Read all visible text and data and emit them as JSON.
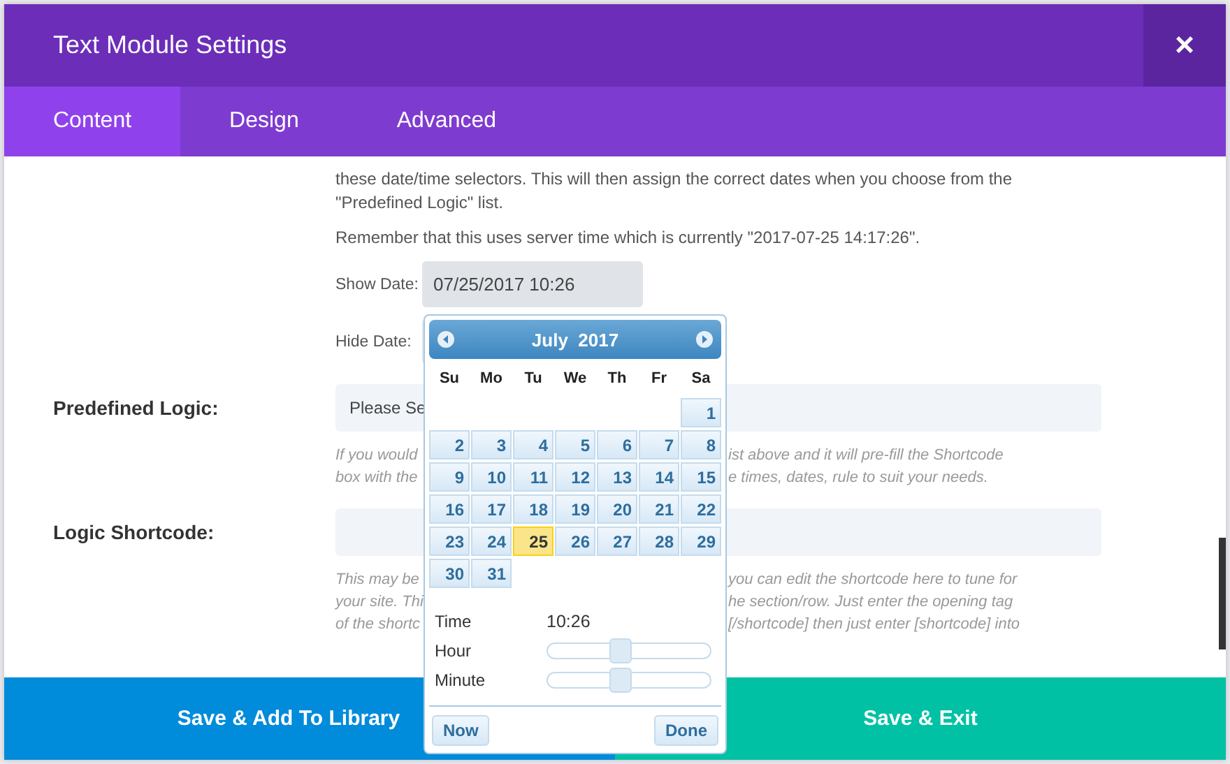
{
  "window": {
    "title": "Text Module Settings",
    "close": "×"
  },
  "tabs": [
    {
      "label": "Content",
      "selected": true
    },
    {
      "label": "Design",
      "selected": false
    },
    {
      "label": "Advanced",
      "selected": false
    }
  ],
  "intro": [
    "these date/time selectors. This will then assign the correct dates when you choose from the \"Predefined Logic\" list.",
    "Remember that this uses server time which is currently \"2017-07-25 14:17:26\"."
  ],
  "show_date": {
    "label": "Show Date:",
    "value": "07/25/2017 10:26"
  },
  "hide_date": {
    "label": "Hide Date:"
  },
  "predefined": {
    "label": "Predefined Logic:",
    "value": "Please Se",
    "help": [
      [
        "If you would",
        "ist above and it will pre-fill the Shortcode"
      ],
      [
        "box with the",
        "e times, dates, rule to suit your needs."
      ]
    ]
  },
  "shortcode": {
    "label": "Logic Shortcode:",
    "help": [
      [
        "This may be",
        "you can edit the shortcode here to tune for"
      ],
      [
        "your site. Thi",
        "he section/row. Just enter the opening tag"
      ],
      [
        "of the shortc",
        "[/shortcode] then just enter [shortcode] into"
      ]
    ]
  },
  "footer": {
    "left": "Save & Add To Library",
    "right": "Save & Exit"
  },
  "datepicker": {
    "month": "July  2017",
    "weekdays": [
      "Su",
      "Mo",
      "Tu",
      "We",
      "Th",
      "Fr",
      "Sa"
    ],
    "weeks": [
      {
        "kind": "lead",
        "days": [
          {
            "day": "1",
            "selected": false
          }
        ]
      },
      {
        "kind": "full",
        "days": [
          {
            "day": "2",
            "selected": false
          },
          {
            "day": "3",
            "selected": false
          },
          {
            "day": "4",
            "selected": false
          },
          {
            "day": "5",
            "selected": false
          },
          {
            "day": "6",
            "selected": false
          },
          {
            "day": "7",
            "selected": false
          },
          {
            "day": "8",
            "selected": false
          }
        ]
      },
      {
        "kind": "full",
        "days": [
          {
            "day": "9",
            "selected": false
          },
          {
            "day": "10",
            "selected": false
          },
          {
            "day": "11",
            "selected": false
          },
          {
            "day": "12",
            "selected": false
          },
          {
            "day": "13",
            "selected": false
          },
          {
            "day": "14",
            "selected": false
          },
          {
            "day": "15",
            "selected": false
          }
        ]
      },
      {
        "kind": "full",
        "days": [
          {
            "day": "16",
            "selected": false
          },
          {
            "day": "17",
            "selected": false
          },
          {
            "day": "18",
            "selected": false
          },
          {
            "day": "19",
            "selected": false
          },
          {
            "day": "20",
            "selected": false
          },
          {
            "day": "21",
            "selected": false
          },
          {
            "day": "22",
            "selected": false
          }
        ]
      },
      {
        "kind": "full",
        "days": [
          {
            "day": "23",
            "selected": false
          },
          {
            "day": "24",
            "selected": false
          },
          {
            "day": "25",
            "selected": true
          },
          {
            "day": "26",
            "selected": false
          },
          {
            "day": "27",
            "selected": false
          },
          {
            "day": "28",
            "selected": false
          },
          {
            "day": "29",
            "selected": false
          }
        ]
      },
      {
        "kind": "trail",
        "days": [
          {
            "day": "30",
            "selected": false
          },
          {
            "day": "31",
            "selected": false
          }
        ]
      }
    ],
    "time_label": "Time",
    "time_value": "10:26",
    "sliders": [
      {
        "label": "Hour",
        "level": 0.44
      },
      {
        "label": "Minute",
        "level": 0.44
      }
    ],
    "buttons": [
      "Now",
      "Done"
    ]
  }
}
